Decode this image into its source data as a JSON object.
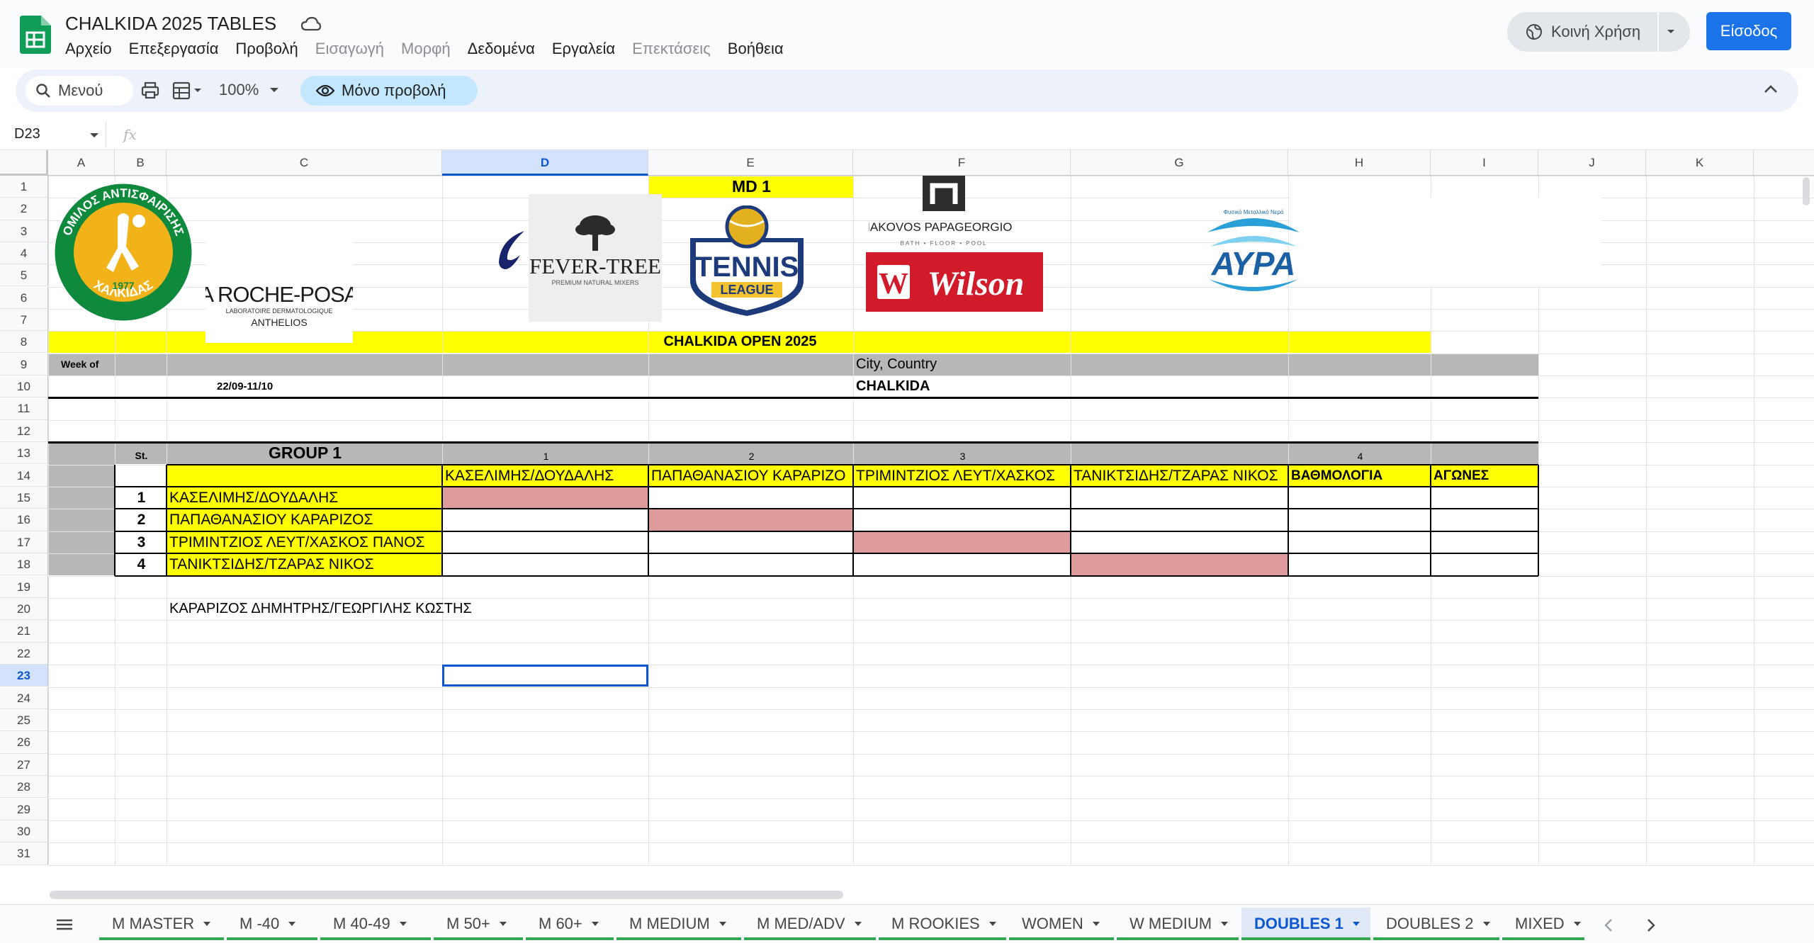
{
  "app": {
    "title": "CHALKIDA 2025 TABLES",
    "menu": [
      "Αρχείο",
      "Επεξεργασία",
      "Προβολή",
      "Εισαγωγή",
      "Μορφή",
      "Δεδομένα",
      "Εργαλεία",
      "Επεκτάσεις",
      "Βοήθεια"
    ],
    "share_label": "Κοινή Χρήση",
    "signin_label": "Είσοδος"
  },
  "toolbar": {
    "search_label": "Μενού",
    "zoom": "100%",
    "view_only_label": "Μόνο προβολή"
  },
  "formula_bar": {
    "cell_ref": "D23",
    "fx": "fx",
    "value": ""
  },
  "columns": [
    "A",
    "B",
    "C",
    "D",
    "E",
    "F",
    "G",
    "H",
    "I",
    "J",
    "K"
  ],
  "rows": [
    "1",
    "2",
    "3",
    "4",
    "5",
    "6",
    "7",
    "8",
    "9",
    "10",
    "11",
    "12",
    "13",
    "14",
    "15",
    "16",
    "17",
    "18",
    "19",
    "20",
    "21",
    "22",
    "23",
    "24",
    "25",
    "26",
    "27",
    "28",
    "29",
    "30",
    "31"
  ],
  "selected_cell": "D23",
  "sheet": {
    "md_label": "MD 1",
    "sponsors": {
      "club_logo_text": "ΟΜΙΛΟΣ ΑΝΤΙΣΦΑΙΡΙΣΗΣ ΧΑΛΚΙΔΑΣ",
      "club_year": "1977",
      "laroche": "LA ROCHE-POSAY",
      "laroche_sub": "LABORATOIRE DERMATOLOGIQUE",
      "laroche_sub2": "ANTHELIOS",
      "fevertree": "FEVER-TREE",
      "fevertree_sub": "PREMIUM NATURAL MIXERS",
      "tennis_league": "TENNIS",
      "tennis_league_sub": "LEAGUE",
      "papageorgiou": "IAKOVOS PAPAGEORGIOU",
      "papageorgiou_sub": "BATH • FLOOR • POOL",
      "wilson": "Wilson",
      "avra": "ΑΥΡΑ",
      "avra_sub": "Φυσικό Μεταλλικό Νερό"
    },
    "tournament": "CHALKIDA OPEN 2025",
    "week_label": "Week of",
    "week_value": "22/09-11/10",
    "city_label": "City, Country",
    "city_value": "CHALKIDA",
    "group": {
      "title": "GROUP 1",
      "st_label": "St.",
      "col_numbers": [
        "1",
        "2",
        "3",
        "4"
      ],
      "players": [
        {
          "num": "1",
          "name": "ΚΑΣΕΛΙΜΗΣ/ΔΟΥΔΑΛΗΣ"
        },
        {
          "num": "2",
          "name": "ΠΑΠΑΘΑΝΑΣΙΟΥ ΚΑΡΑΡΙΖΟΣ"
        },
        {
          "num": "3",
          "name": "ΤΡΙΜΙΝΤΖΙΟΣ ΛΕΥΤ/ΧΑΣΚΟΣ ΠΑΝΟΣ"
        },
        {
          "num": "4",
          "name": "ΤΑΝΙΚΤΣΙΔΗΣ/ΤΖΑΡΑΣ ΝΙΚΟΣ"
        }
      ],
      "header_names": [
        "ΚΑΣΕΛΙΜΗΣ/ΔΟΥΔΑΛΗΣ",
        "ΠΑΠΑΘΑΝΑΣΙΟΥ ΚΑΡΑΡΙΖΟ",
        "ΤΡΙΜΙΝΤΖΙΟΣ ΛΕΥΤ/ΧΑΣΚΟΣ",
        "ΤΑΝΙΚΤΣΙΔΗΣ/ΤΖΑΡΑΣ ΝΙΚΟΣ"
      ],
      "points_label": "ΒΑΘΜΟΛΟΓΙΑ",
      "matches_label": "ΑΓΩΝΕΣ"
    },
    "note": "ΚΑΡΑΡΙΖΟΣ ΔΗΜΗΤΡΗΣ/ΓΕΩΡΓΙΛΗΣ ΚΩΣΤΗΣ"
  },
  "sheet_tabs": [
    {
      "label": "M MASTER"
    },
    {
      "label": "M -40"
    },
    {
      "label": "M 40-49"
    },
    {
      "label": "M 50+"
    },
    {
      "label": "M 60+"
    },
    {
      "label": "M MEDIUM"
    },
    {
      "label": "M MED/ADV"
    },
    {
      "label": "M ROOKIES"
    },
    {
      "label": "WOMEN"
    },
    {
      "label": "W MEDIUM"
    },
    {
      "label": "DOUBLES 1"
    },
    {
      "label": "DOUBLES 2"
    },
    {
      "label": "MIXED"
    }
  ],
  "active_tab": "DOUBLES 1",
  "colors": {
    "yellow": "#ffff00",
    "gray": "#b7b7b7",
    "diagonal": "#dd9b9b",
    "tab_underline": "#34a853",
    "accent": "#1a73e8"
  }
}
